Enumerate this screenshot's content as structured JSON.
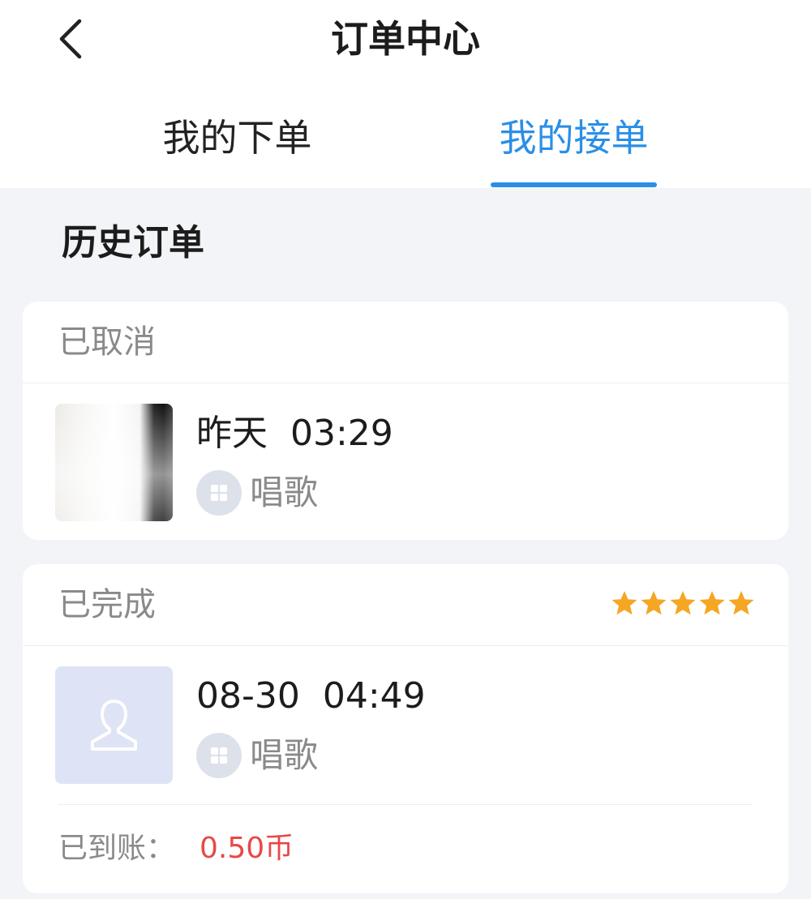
{
  "header": {
    "title": "订单中心",
    "back_icon": "chevron-left-icon"
  },
  "tabs": [
    {
      "label": "我的下单",
      "active": false
    },
    {
      "label": "我的接单",
      "active": true
    }
  ],
  "colors": {
    "accent": "#2a8fe6",
    "star": "#f5a623",
    "amount": "#e84848",
    "muted_text": "#8a8a8a",
    "background": "#f2f4f8"
  },
  "section": {
    "title": "历史订单"
  },
  "orders": [
    {
      "status": "已取消",
      "time": "昨天  03:29",
      "service": "唱歌",
      "service_icon": "grid-icon",
      "thumbnail": "blurred-photo"
    },
    {
      "status": "已完成",
      "rating": 5,
      "time": "08-30  04:49",
      "service": "唱歌",
      "service_icon": "grid-icon",
      "thumbnail": "avatar-placeholder-icon",
      "payout_label": "已到账：",
      "payout_amount": "0.50币"
    }
  ]
}
